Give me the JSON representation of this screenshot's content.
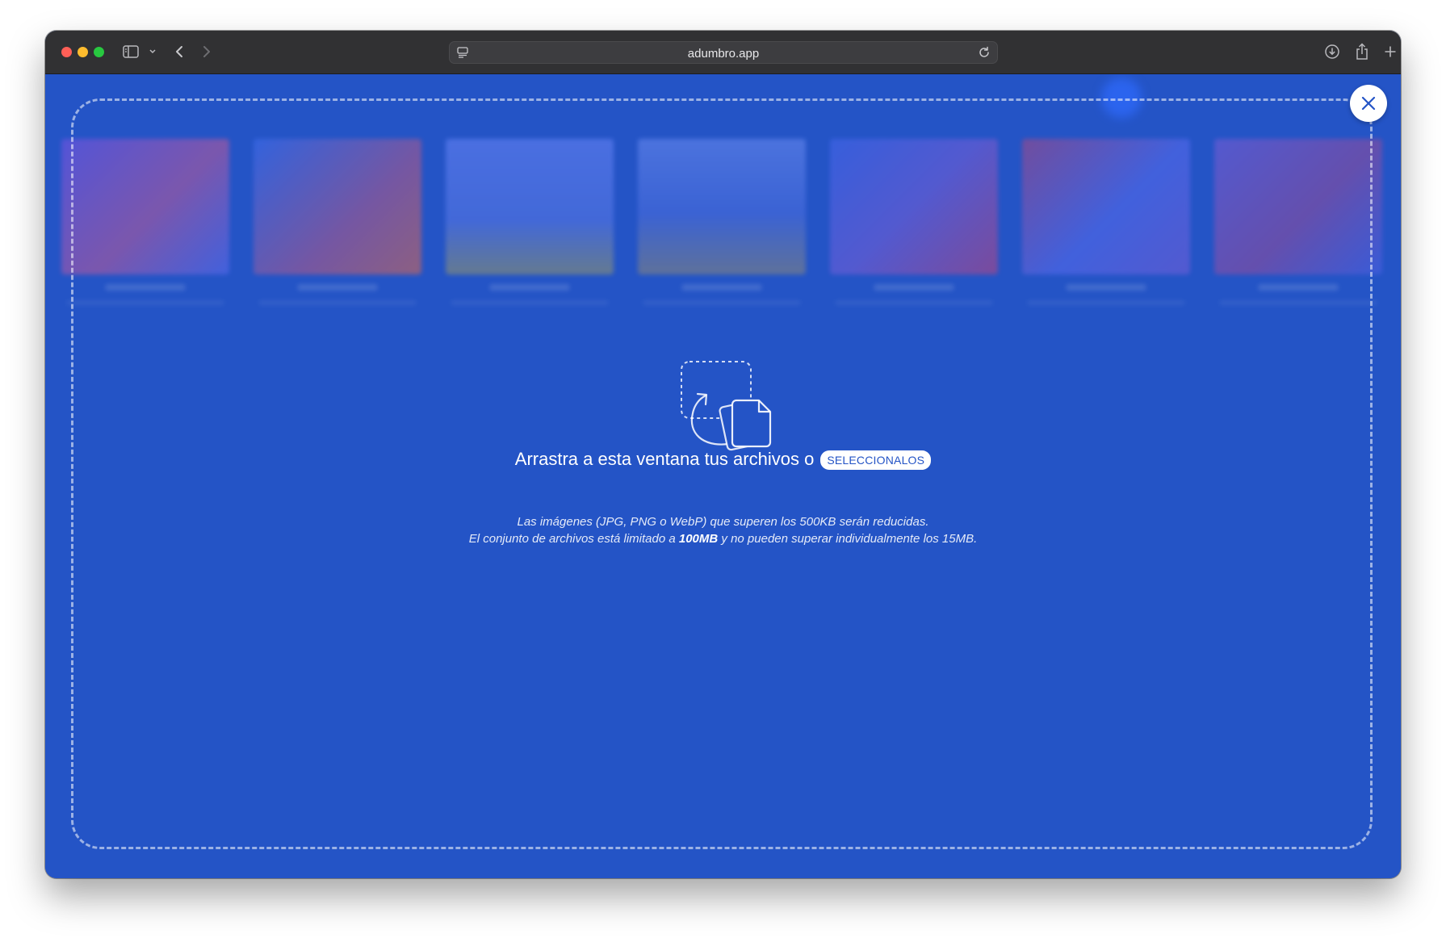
{
  "browser": {
    "url": "adumbro.app"
  },
  "dropzone": {
    "headline": "Arrastra a esta ventana tus archivos o",
    "select_button": "SELECCIONALOS",
    "note_line1": "Las imágenes (JPG, PNG o WebP) que superen los 500KB serán reducidas.",
    "note_line2_pre": "El conjunto de archivos está limitado a ",
    "note_line2_bold": "100MB",
    "note_line2_post": " y no pueden superar individualmente los 15MB."
  },
  "icons": {
    "close": "close-icon",
    "upload": "drag-files-icon"
  },
  "colors": {
    "overlay": "#2454c6",
    "accent": "#2f6bff",
    "titlebar": "#313133"
  }
}
